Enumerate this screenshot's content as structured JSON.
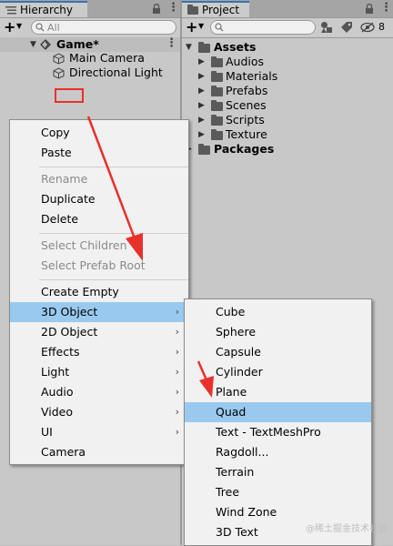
{
  "hierarchy": {
    "tab_label": "Hierarchy",
    "add_label": "+",
    "search_placeholder": "All",
    "scene_name": "Game*",
    "objects": [
      "Main Camera",
      "Directional Light"
    ]
  },
  "project": {
    "tab_label": "Project",
    "add_label": "+",
    "hidden_count": "8",
    "root_folder": "Assets",
    "folders": [
      "Audios",
      "Materials",
      "Prefabs",
      "Scenes",
      "Scripts",
      "Texture"
    ],
    "packages": "Packages"
  },
  "context_menu": {
    "items": [
      "Copy",
      "Paste",
      "Rename",
      "Duplicate",
      "Delete",
      "Select Children",
      "Select Prefab Root",
      "Create Empty",
      "3D Object",
      "2D Object",
      "Effects",
      "Light",
      "Audio",
      "Video",
      "UI",
      "Camera"
    ]
  },
  "submenu_3d": {
    "items": [
      "Cube",
      "Sphere",
      "Capsule",
      "Cylinder",
      "Plane",
      "Quad",
      "Text - TextMeshPro",
      "Ragdoll...",
      "Terrain",
      "Tree",
      "Wind Zone",
      "3D Text"
    ]
  },
  "watermark": "@稀土掘金技术社区",
  "colors": {
    "panel_bg": "#c8c8c8",
    "menu_bg": "#f1f1f1",
    "selection": "#99c9ef",
    "annotation_red": "#e8312b"
  }
}
